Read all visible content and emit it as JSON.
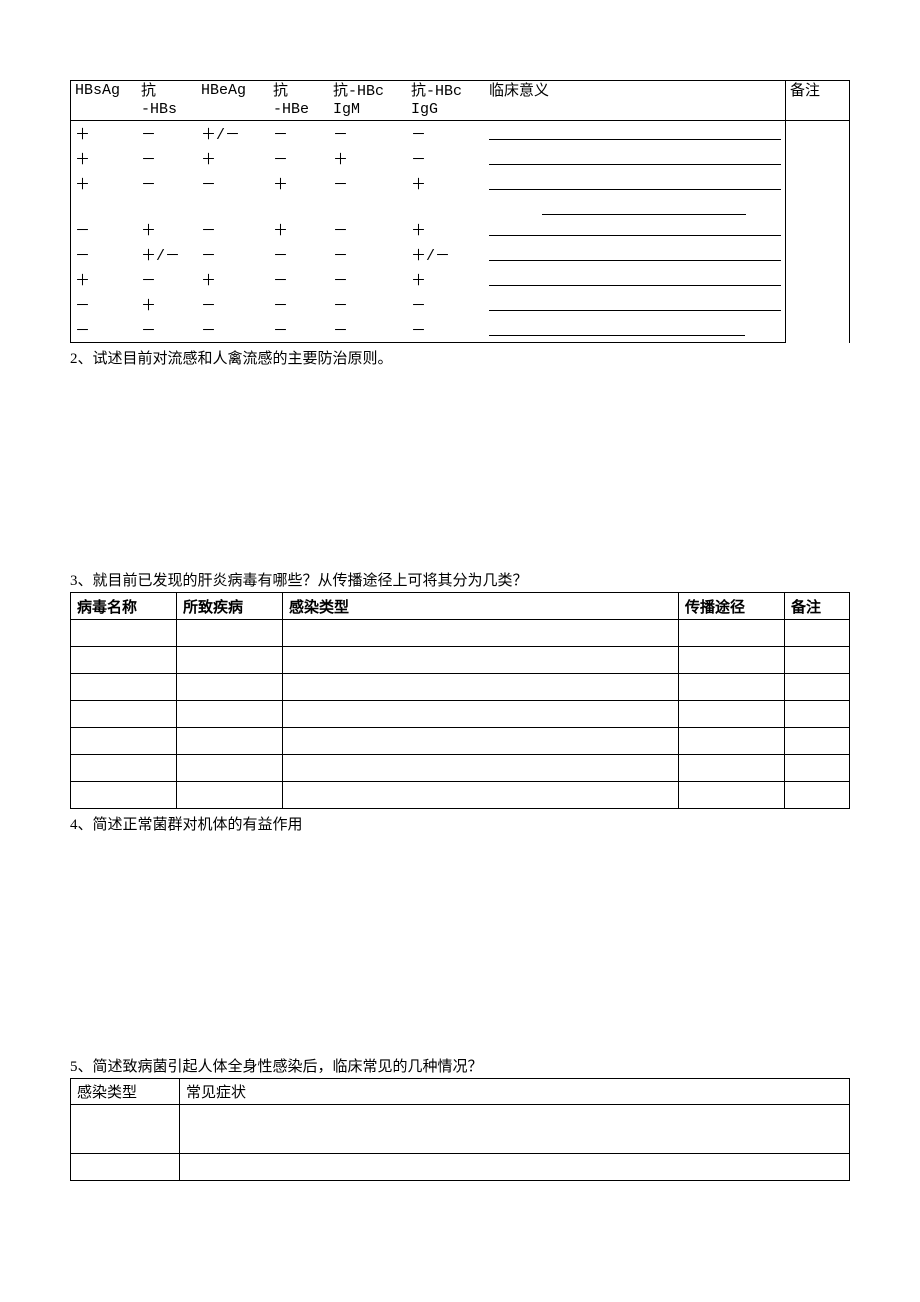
{
  "table1": {
    "headers": [
      "HBsAg",
      "抗\n-HBs",
      "HBeAg",
      "抗\n-HBe",
      "抗-HBc\nIgM",
      "抗-HBc\nIgG",
      "临床意义",
      "备注"
    ],
    "rows": [
      [
        "＋",
        "－",
        "＋/－",
        "－",
        "－",
        "－"
      ],
      [
        "＋",
        "－",
        "＋",
        "－",
        "＋",
        "－"
      ],
      [
        "＋",
        "－",
        "－",
        "＋",
        "－",
        "＋"
      ],
      [
        "－",
        "＋",
        "－",
        "＋",
        "－",
        "＋"
      ],
      [
        "－",
        "＋/－",
        "－",
        "－",
        "－",
        "＋/－"
      ],
      [
        "＋",
        "－",
        "＋",
        "－",
        "－",
        "＋"
      ],
      [
        "－",
        "＋",
        "－",
        "－",
        "－",
        "－"
      ],
      [
        "－",
        "－",
        "－",
        "－",
        "－",
        "－"
      ]
    ]
  },
  "q2": {
    "text": "2、试述目前对流感和人禽流感的主要防治原则。"
  },
  "q3": {
    "text": "3、就目前已发现的肝炎病毒有哪些？从传播途径上可将其分为几类？",
    "headers": [
      "病毒名称",
      "所致疾病",
      "感染类型",
      "传播途径",
      "备注"
    ],
    "rowCount": 7
  },
  "q4": {
    "text": "4、简述正常菌群对机体的有益作用"
  },
  "q5": {
    "text": "5、简述致病菌引起人体全身性感染后，临床常见的几种情况？",
    "headers": [
      "感染类型",
      "常见症状"
    ]
  }
}
